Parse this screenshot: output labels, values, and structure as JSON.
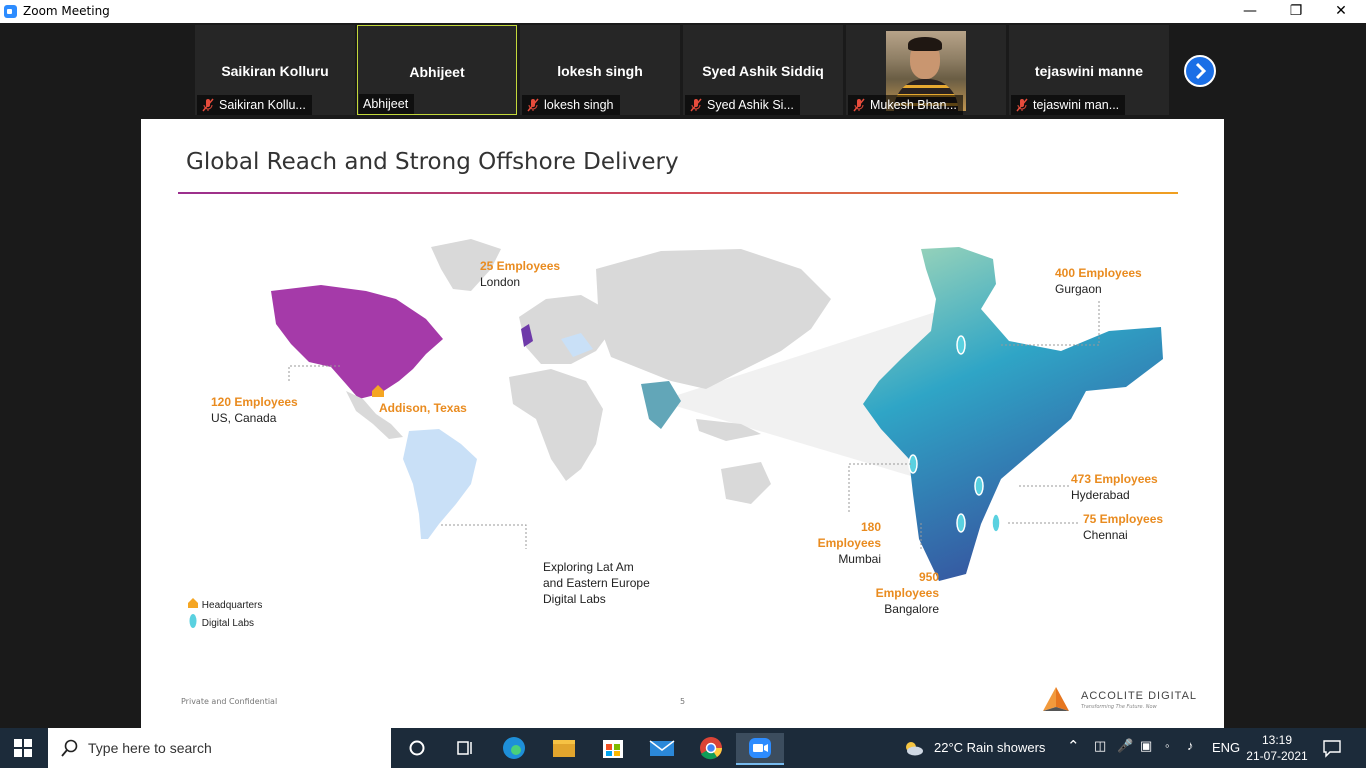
{
  "window": {
    "title": "Zoom Meeting"
  },
  "participants": [
    {
      "name": "Saikiran Kolluru",
      "label": "Saikiran Kollu..."
    },
    {
      "name": "Abhijeet",
      "label": "Abhijeet"
    },
    {
      "name": "lokesh singh",
      "label": "lokesh singh"
    },
    {
      "name": "Syed Ashik Siddiq",
      "label": "Syed Ashik Si..."
    },
    {
      "name": "",
      "label": "Mukesh Bhan..."
    },
    {
      "name": "tejaswini manne",
      "label": "tejaswini man..."
    }
  ],
  "slide": {
    "title": "Global Reach and Strong Offshore Delivery",
    "locations": {
      "london": {
        "count": "25 Employees",
        "place": "London"
      },
      "us": {
        "count": "120 Employees",
        "place": "US, Canada"
      },
      "hq": {
        "place": "Addison, Texas"
      },
      "latam": {
        "text": "Exploring Lat Am and Eastern Europe Digital Labs"
      },
      "gurgaon": {
        "count": "400 Employees",
        "place": "Gurgaon"
      },
      "hyderabad": {
        "count": "473 Employees",
        "place": "Hyderabad"
      },
      "chennai": {
        "count": "75 Employees",
        "place": "Chennai"
      },
      "mumbai": {
        "count": "180 Employees",
        "place": "Mumbai"
      },
      "bangalore": {
        "count": "950 Employees",
        "place": "Bangalore"
      }
    },
    "legend": {
      "hq": "Headquarters",
      "labs": "Digital Labs"
    },
    "footer": {
      "confidential": "Private and Confidential",
      "page": "5"
    },
    "logo": {
      "brand": "ACCOLITE DIGITAL",
      "tagline": "Transforming The Future. Now"
    },
    "colors": {
      "americas": "#a53aa9",
      "latam": "#c9e0f7",
      "india": "#3a8fc0",
      "accent": "#e98b1f"
    }
  },
  "taskbar": {
    "search_placeholder": "Type here to search",
    "weather": "22°C  Rain showers",
    "lang": "ENG",
    "time": "13:19",
    "date": "21-07-2021",
    "apps": [
      "cortana-icon",
      "task-view-icon",
      "edge-icon",
      "file-explorer-icon",
      "store-icon",
      "mail-icon",
      "chrome-icon",
      "zoom-icon"
    ]
  }
}
